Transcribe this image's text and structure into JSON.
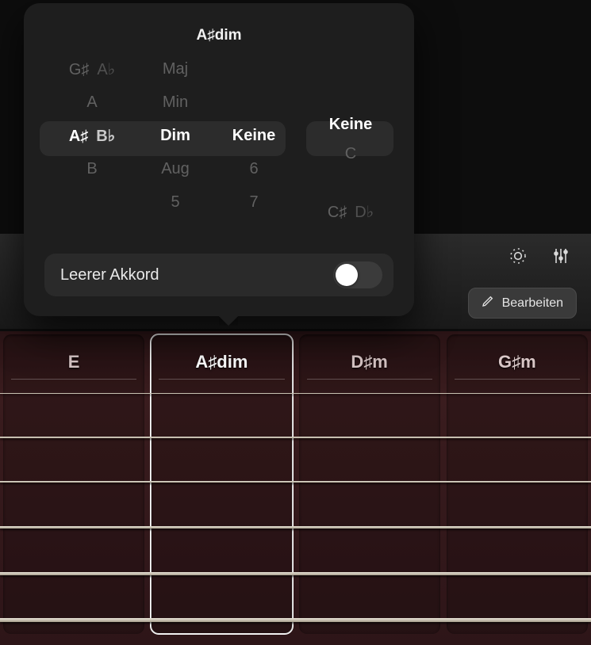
{
  "popover": {
    "title": "A♯dim",
    "root_wheel": {
      "items": [
        {
          "main": "G♯",
          "alt": "A♭"
        },
        {
          "main": "A",
          "alt": ""
        },
        {
          "main": "A♯",
          "alt": "B♭",
          "selected": true
        },
        {
          "main": "B",
          "alt": ""
        }
      ]
    },
    "quality_wheel": {
      "items": [
        "Maj",
        "Min",
        "Dim",
        "Aug",
        "5"
      ],
      "selected_index": 2
    },
    "tension_wheel": {
      "items": [
        "",
        "",
        "Keine",
        "6",
        "7"
      ],
      "selected_index": 2
    },
    "bass_wheel": {
      "items": [
        "",
        "",
        "Keine",
        "C",
        ""
      ],
      "selected_index": 2,
      "trailing": {
        "main": "C♯",
        "alt": "D♭"
      }
    },
    "empty_chord": {
      "label": "Leerer Akkord",
      "on": false
    }
  },
  "toolbar": {
    "edit_label": "Bearbeiten"
  },
  "chords": [
    {
      "label": "E",
      "selected": false
    },
    {
      "label": "A♯dim",
      "selected": true
    },
    {
      "label": "D♯m",
      "selected": false
    },
    {
      "label": "G♯m",
      "selected": false
    }
  ]
}
